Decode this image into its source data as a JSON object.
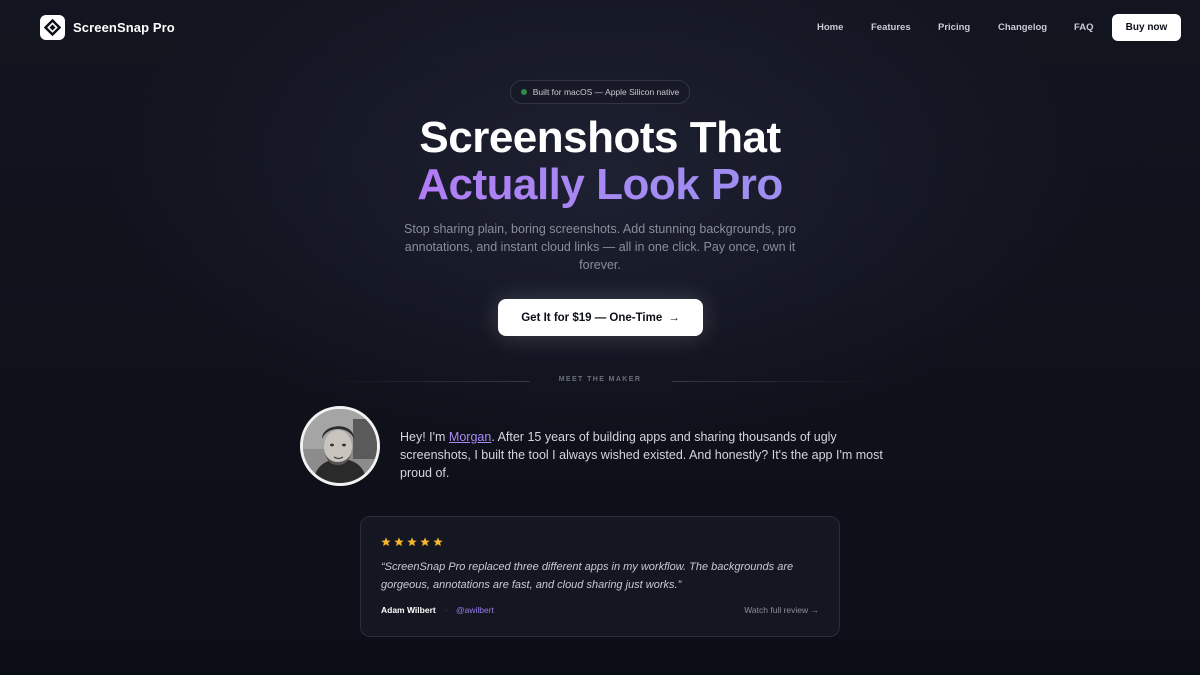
{
  "nav": {
    "brand": "ScreenSnap Pro",
    "links": [
      "Home",
      "Features",
      "Pricing",
      "Changelog",
      "FAQ"
    ],
    "buy_label": "Buy now"
  },
  "hero": {
    "badge": "Built for macOS — Apple Silicon native",
    "title_line1": "Screenshots That",
    "title_line2": "Actually Look Pro",
    "subtitle": "Stop sharing plain, boring screenshots. Add stunning backgrounds, pro annotations, and instant cloud links — all in one click. Pay once, own it forever.",
    "cta_label": "Get It for $19 — One-Time",
    "cta_arrow": "→"
  },
  "maker": {
    "section_label": "MEET THE MAKER",
    "text_before": "Hey! I'm ",
    "name": "Morgan",
    "text_after": ". After 15 years of building apps and sharing thousands of ugly screenshots, I built the tool I always wished existed. And honestly? It's the app I'm most proud of."
  },
  "testimonial": {
    "rating": 5,
    "quote": "“ScreenSnap Pro replaced three different apps in my workflow. The backgrounds are gorgeous, annotations are fast, and cloud sharing just works.”",
    "author": "Adam Wilbert",
    "separator": "·",
    "handle": "@awilbert",
    "link_label": "Watch full review →"
  },
  "colors": {
    "background": "#0d0f18",
    "accent_purple": "#a88bf3",
    "star": "#f5b62a"
  }
}
